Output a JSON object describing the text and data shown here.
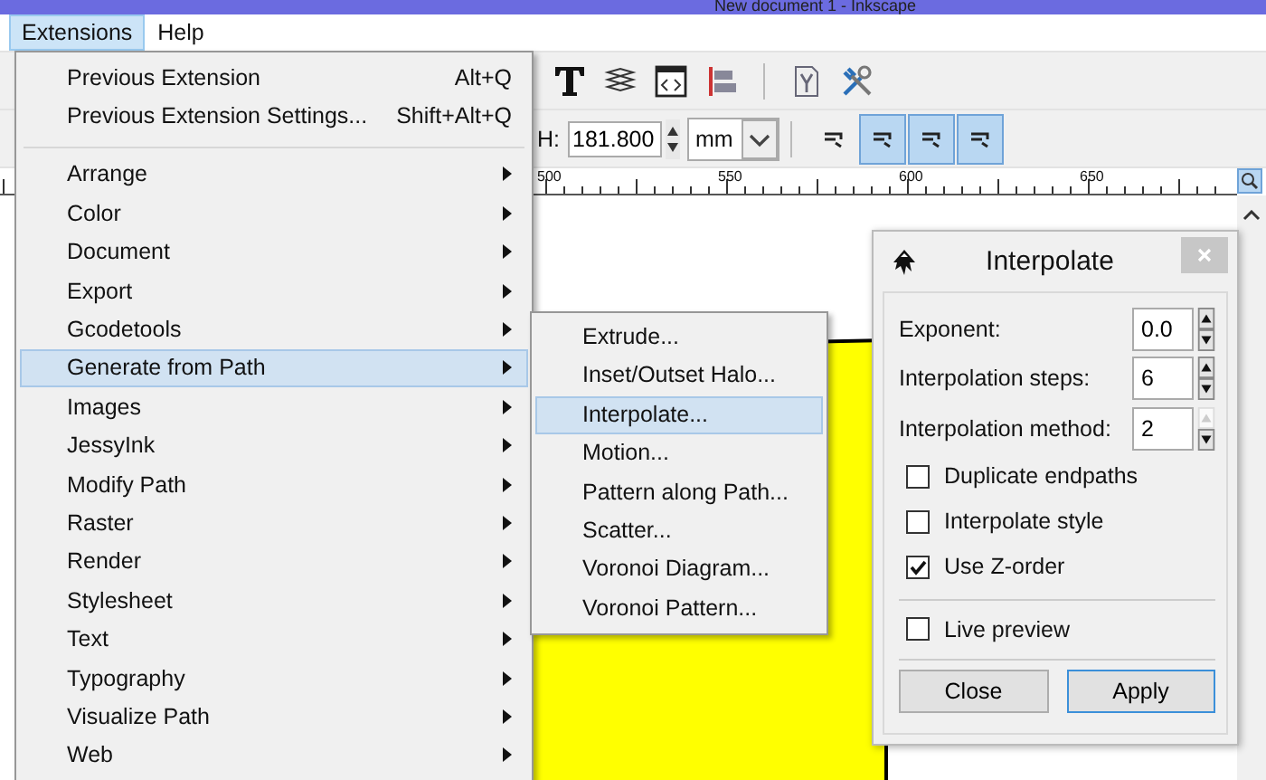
{
  "window": {
    "title": "New document 1 - Inkscape"
  },
  "menubar": [
    {
      "label": "Extensions",
      "selected": true
    },
    {
      "label": "Help",
      "selected": false
    }
  ],
  "tool_controls": {
    "h_label": "H:",
    "h_value": "181.800",
    "unit": "mm",
    "toggles": [
      {
        "on": false
      },
      {
        "on": true
      },
      {
        "on": true
      },
      {
        "on": true
      }
    ]
  },
  "ruler": {
    "labels": [
      "500",
      "550",
      "600",
      "650"
    ]
  },
  "extensions_menu": {
    "recent": [
      {
        "label": "Previous Extension",
        "shortcut": "Alt+Q",
        "selected": false
      },
      {
        "label": "Previous Extension Settings...",
        "shortcut": "Shift+Alt+Q",
        "selected": false
      }
    ],
    "submenus": [
      {
        "label": "Arrange",
        "selected": false
      },
      {
        "label": "Color",
        "selected": false
      },
      {
        "label": "Document",
        "selected": false
      },
      {
        "label": "Export",
        "selected": false
      },
      {
        "label": "Gcodetools",
        "selected": false
      },
      {
        "label": "Generate from Path",
        "selected": true
      },
      {
        "label": "Images",
        "selected": false
      },
      {
        "label": "JessyInk",
        "selected": false
      },
      {
        "label": "Modify Path",
        "selected": false
      },
      {
        "label": "Raster",
        "selected": false
      },
      {
        "label": "Render",
        "selected": false
      },
      {
        "label": "Stylesheet",
        "selected": false
      },
      {
        "label": "Text",
        "selected": false
      },
      {
        "label": "Typography",
        "selected": false
      },
      {
        "label": "Visualize Path",
        "selected": false
      },
      {
        "label": "Web",
        "selected": false
      }
    ]
  },
  "generate_submenu": {
    "items": [
      {
        "label": "Extrude...",
        "selected": false
      },
      {
        "label": "Inset/Outset Halo...",
        "selected": false
      },
      {
        "label": "Interpolate...",
        "selected": true
      },
      {
        "label": "Motion...",
        "selected": false
      },
      {
        "label": "Pattern along Path...",
        "selected": false
      },
      {
        "label": "Scatter...",
        "selected": false
      },
      {
        "label": "Voronoi Diagram...",
        "selected": false
      },
      {
        "label": "Voronoi Pattern...",
        "selected": false
      }
    ]
  },
  "dialog": {
    "title": "Interpolate",
    "fields": [
      {
        "label": "Exponent:",
        "value": "0.0",
        "up_disabled": false
      },
      {
        "label": "Interpolation steps:",
        "value": "6",
        "up_disabled": false
      },
      {
        "label": "Interpolation method:",
        "value": "2",
        "up_disabled": true
      }
    ],
    "options": [
      {
        "label": "Duplicate endpaths",
        "checked": false
      },
      {
        "label": "Interpolate style",
        "checked": false
      },
      {
        "label": "Use Z-order",
        "checked": true
      }
    ],
    "live_preview": {
      "label": "Live preview",
      "checked": false
    },
    "buttons": [
      {
        "label": "Close",
        "default": false
      },
      {
        "label": "Apply",
        "default": true
      }
    ]
  }
}
